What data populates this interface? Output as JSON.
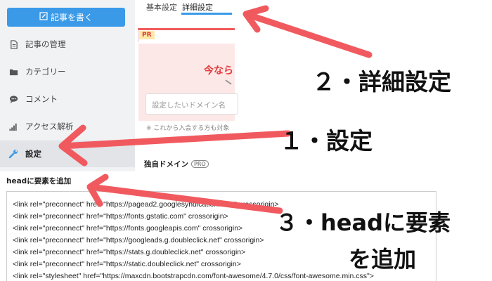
{
  "sidebar": {
    "write_button": "記事を書く",
    "items": [
      {
        "label": "記事の管理",
        "icon": "document-icon"
      },
      {
        "label": "カテゴリー",
        "icon": "folder-icon"
      },
      {
        "label": "コメント",
        "icon": "comment-icon"
      },
      {
        "label": "アクセス解析",
        "icon": "bar-chart-icon"
      },
      {
        "label": "設定",
        "icon": "wrench-icon"
      }
    ],
    "active_index": 4
  },
  "tabs": [
    {
      "label": "基本設定"
    },
    {
      "label": "詳細設定",
      "active": true
    }
  ],
  "panel": {
    "pr_badge": "PR",
    "promo_text": "今なら",
    "domain_placeholder": "設定したいドメイン名",
    "note": "※ これから入会する方も対象",
    "own_domain_label": "独自ドメイン",
    "pro_badge": "PRO"
  },
  "head": {
    "title": "headに要素を追加",
    "code_lines": [
      "<link rel=\"preconnect\" href=\"https://pagead2.googlesyndication.com\" crossorigin>",
      "<link rel=\"preconnect\" href=\"https://fonts.gstatic.com\" crossorigin>",
      "<link rel=\"preconnect\" href=\"https://fonts.googleapis.com\" crossorigin>",
      "<link rel=\"preconnect\" href=\"https://googleads.g.doubleclick.net\" crossorigin>",
      "<link rel=\"preconnect\" href=\"https://stats.g.doubleclick.net\" crossorigin>",
      "<link rel=\"preconnect\" href=\"https://static.doubleclick.net\" crossorigin>",
      "<link rel=\"stylesheet\" href=\"https://maxcdn.bootstrapcdn.com/font-awesome/4.7.0/css/font-awesome.min.css\">"
    ]
  },
  "annotations": {
    "step1": "１・設定",
    "step2": "２・詳細設定",
    "step3_line1": "３・headに要素",
    "step3_line2": "を追加",
    "arrow_color": "#f05a5f"
  },
  "colors": {
    "accent": "#3a9ae8",
    "sidebar_bg": "#f1f2f4",
    "promo_red": "#e23b3b"
  }
}
